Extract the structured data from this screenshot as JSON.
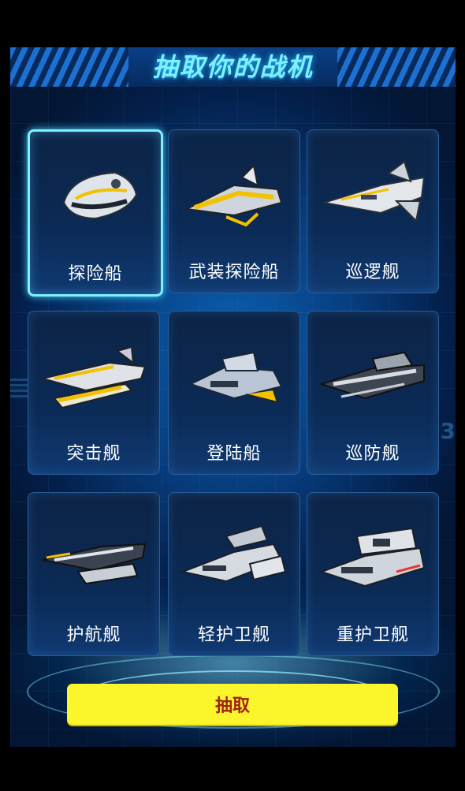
{
  "title": "抽取你的战机",
  "ships": [
    {
      "label": "探险船",
      "selected": true
    },
    {
      "label": "武装探险船",
      "selected": false
    },
    {
      "label": "巡逻舰",
      "selected": false
    },
    {
      "label": "突击舰",
      "selected": false
    },
    {
      "label": "登陆船",
      "selected": false
    },
    {
      "label": "巡防舰",
      "selected": false
    },
    {
      "label": "护航舰",
      "selected": false
    },
    {
      "label": "轻护卫舰",
      "selected": false
    },
    {
      "label": "重护卫舰",
      "selected": false
    }
  ],
  "draw_button": {
    "label": "抽取"
  },
  "colors": {
    "accent": "#7ff0ff",
    "button": "#fbf52b",
    "button_text": "#a0221b"
  }
}
